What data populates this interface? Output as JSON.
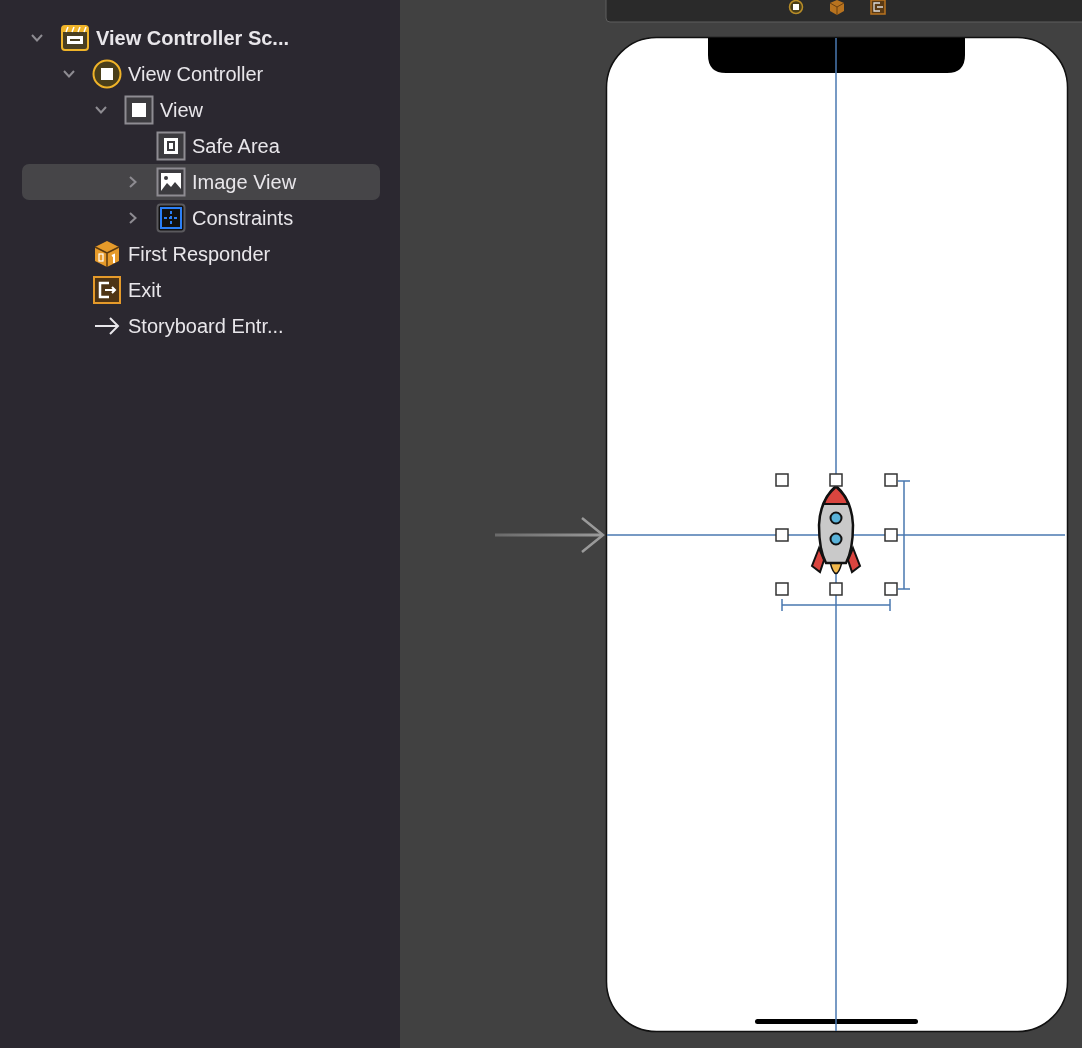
{
  "outline": [
    {
      "label": "View Controller Sc...",
      "kind": "scene",
      "expanded": true,
      "selected": false,
      "children": [
        {
          "label": "View Controller",
          "kind": "controller",
          "expanded": true,
          "selected": false,
          "children": [
            {
              "label": "View",
              "kind": "view",
              "expanded": true,
              "selected": false,
              "children": [
                {
                  "label": "Safe Area",
                  "kind": "safe-area",
                  "selected": false
                },
                {
                  "label": "Image View",
                  "kind": "image-view",
                  "expanded": false,
                  "selected": true
                },
                {
                  "label": "Constraints",
                  "kind": "constraints",
                  "expanded": false,
                  "selected": false
                }
              ]
            }
          ]
        },
        {
          "label": "First Responder",
          "kind": "responder",
          "selected": false
        },
        {
          "label": "Exit",
          "kind": "exit",
          "selected": false
        },
        {
          "label": "Storyboard Entr...",
          "kind": "entry",
          "selected": false
        }
      ]
    }
  ]
}
